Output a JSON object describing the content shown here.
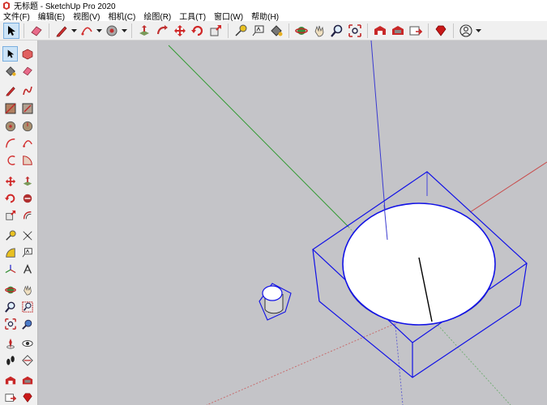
{
  "window": {
    "title": "无标题 - SketchUp Pro 2020"
  },
  "menubar": {
    "items": [
      {
        "label": "文件(F)"
      },
      {
        "label": "编辑(E)"
      },
      {
        "label": "视图(V)"
      },
      {
        "label": "相机(C)"
      },
      {
        "label": "绘图(R)"
      },
      {
        "label": "工具(T)"
      },
      {
        "label": "窗口(W)"
      },
      {
        "label": "帮助(H)"
      }
    ]
  },
  "toolbar": {
    "tools": [
      "select",
      "eraser",
      "pencil-line",
      "arc",
      "paint-bucket",
      "push-pull",
      "follow-me",
      "move",
      "rotate",
      "scale",
      "tape-measure",
      "text",
      "paint",
      "orbit",
      "pan",
      "zoom",
      "zoom-extents",
      "warehouse",
      "extension-warehouse",
      "send-to-layout",
      "ruby-gem",
      "account"
    ],
    "active_tool": "select"
  },
  "left_toolbar": {
    "active_tool": "select"
  },
  "colors": {
    "viewport_bg": "#c4c4c8",
    "selection": "#1212e6",
    "axis_green": "#2f9a2f",
    "axis_red": "#c84a4a",
    "axis_blue": "#3a3ad0"
  }
}
